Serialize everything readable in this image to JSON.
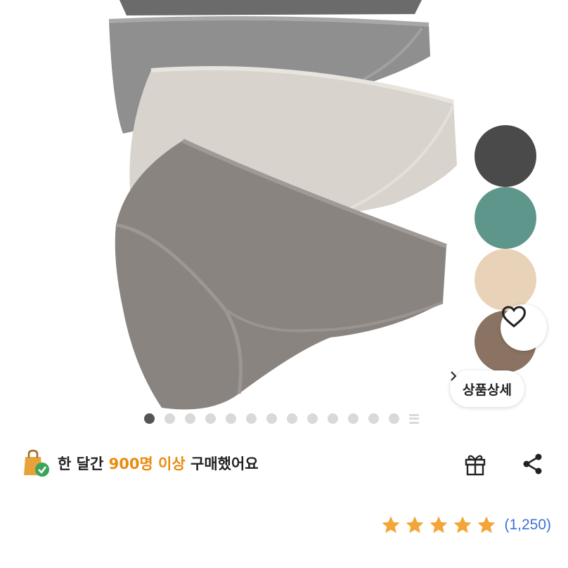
{
  "product": {
    "swatch_colors": [
      "#4a4a4a",
      "#5f968c",
      "#e9d3b8",
      "#8a7362"
    ],
    "detail_button_label": "상품상세",
    "image_page": {
      "current": 1,
      "total": 13
    }
  },
  "purchase_info": {
    "prefix": "한 달간",
    "highlight": "900명 이상",
    "suffix": "구매했어요"
  },
  "rating": {
    "stars": 5,
    "count_text": "(1,250)"
  },
  "colors": {
    "star": "#f3a536",
    "highlight": "#e98b10",
    "link": "#3d6fd8"
  }
}
